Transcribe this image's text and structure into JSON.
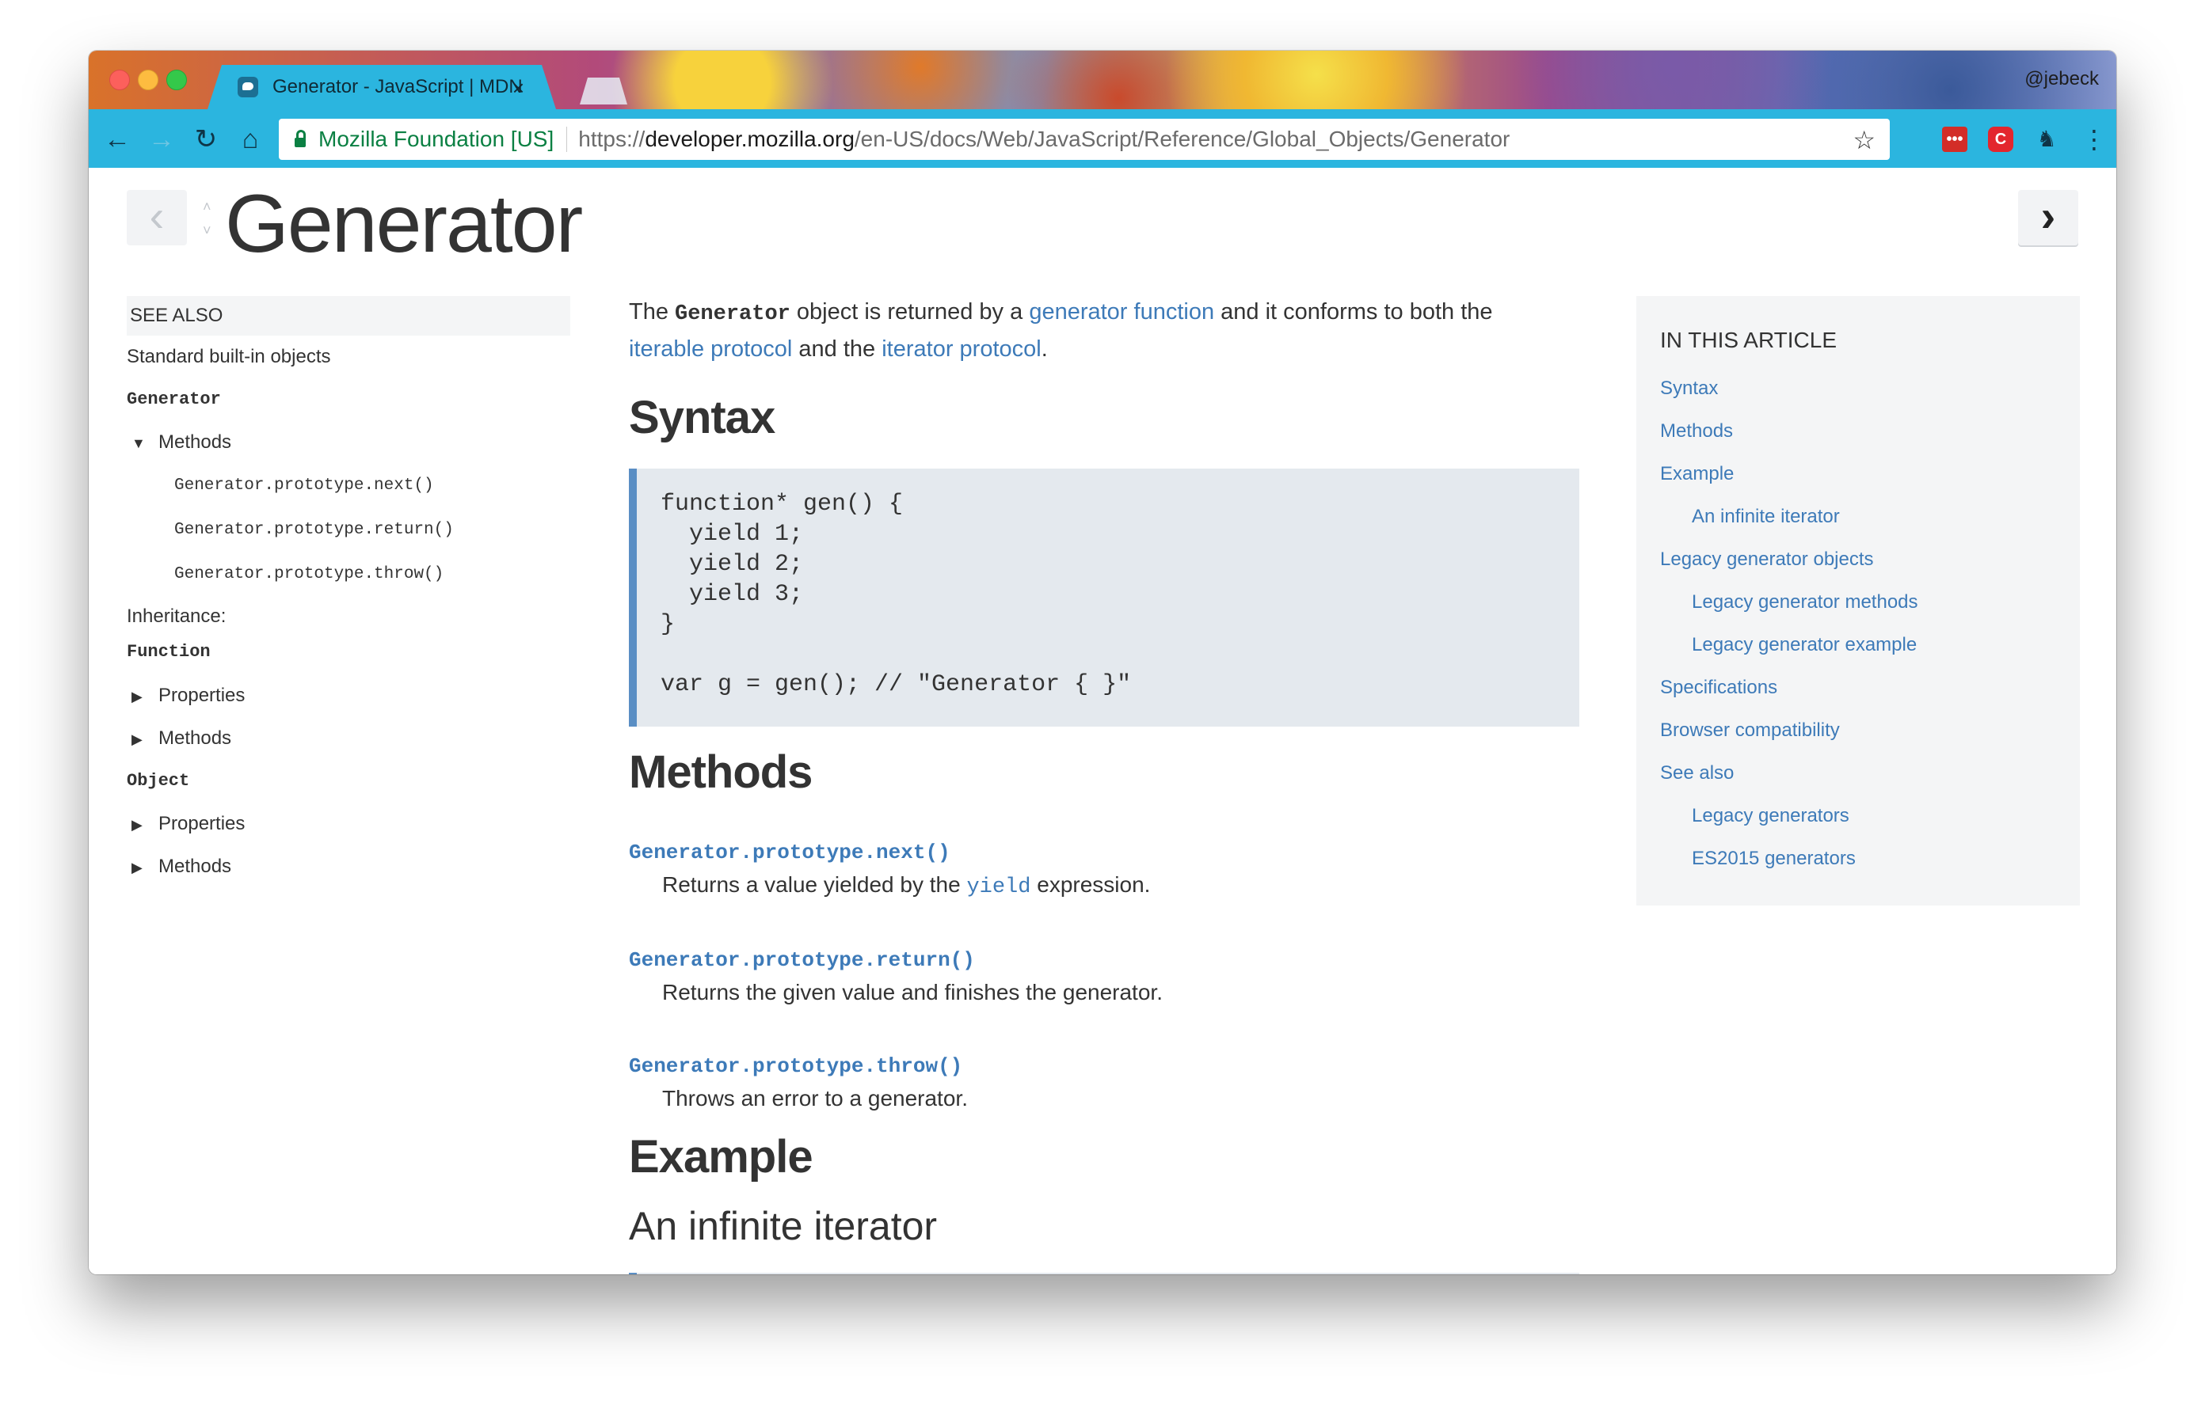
{
  "browser": {
    "tab_title": "Generator - JavaScript | MDN",
    "tab_close": "×",
    "profile": "@jebeck",
    "secure_label": "Mozilla Foundation [US]",
    "url": {
      "scheme": "https://",
      "host": "developer.mozilla.org",
      "path": "/en-US/docs/Web/JavaScript/Reference/Global_Objects/Generator"
    },
    "nav": {
      "back": "←",
      "forward": "→",
      "reload": "↻",
      "home": "⌂"
    },
    "star": "☆",
    "menu": "⋮",
    "extensions": {
      "lastpass": "•••",
      "c": "C",
      "evernote": "♞"
    },
    "colors": {
      "toolbar": "#2bb5df",
      "secure": "#0b8043"
    }
  },
  "page": {
    "title": "Generator",
    "prev": "‹",
    "next": "›",
    "updown_up": "˄",
    "updown_down": "˅"
  },
  "sidebar": {
    "heading": "SEE ALSO",
    "std_objects": "Standard built-in objects",
    "current": "Generator",
    "methods_label": "Methods",
    "methods": [
      "Generator.prototype.next()",
      "Generator.prototype.return()",
      "Generator.prototype.throw()"
    ],
    "inheritance_label": "Inheritance:",
    "function_label": "Function",
    "function_props": "Properties",
    "function_methods": "Methods",
    "object_label": "Object",
    "object_props": "Properties",
    "object_methods": "Methods",
    "tri_open": "▼",
    "tri_closed": "▶"
  },
  "content": {
    "intro": {
      "t1": "The ",
      "code": "Generator",
      "t2": " object is returned by a ",
      "link1": "generator function",
      "t3": " and it conforms to both the ",
      "link2": "iterable protocol",
      "t4": " and the ",
      "link3": "iterator protocol",
      "t5": "."
    },
    "syntax_heading": "Syntax",
    "syntax_code": "function* gen() {\n  yield 1;\n  yield 2;\n  yield 3;\n}\n\nvar g = gen(); // \"Generator { }\"",
    "methods_heading": "Methods",
    "methods": [
      {
        "name": "Generator.prototype.next()",
        "desc_pre": "Returns a value yielded by the ",
        "desc_code": "yield",
        "desc_post": " expression."
      },
      {
        "name": "Generator.prototype.return()",
        "desc": "Returns the given value and finishes the generator."
      },
      {
        "name": "Generator.prototype.throw()",
        "desc": "Throws an error to a generator."
      }
    ],
    "example_heading": "Example",
    "example_subheading": "An infinite iterator"
  },
  "toc": {
    "heading": "IN THIS ARTICLE",
    "items": [
      "Syntax",
      "Methods",
      "Example",
      "An infinite iterator",
      "Legacy generator objects",
      "Legacy generator methods",
      "Legacy generator example",
      "Specifications",
      "Browser compatibility",
      "See also",
      "Legacy generators",
      "ES2015 generators"
    ]
  }
}
